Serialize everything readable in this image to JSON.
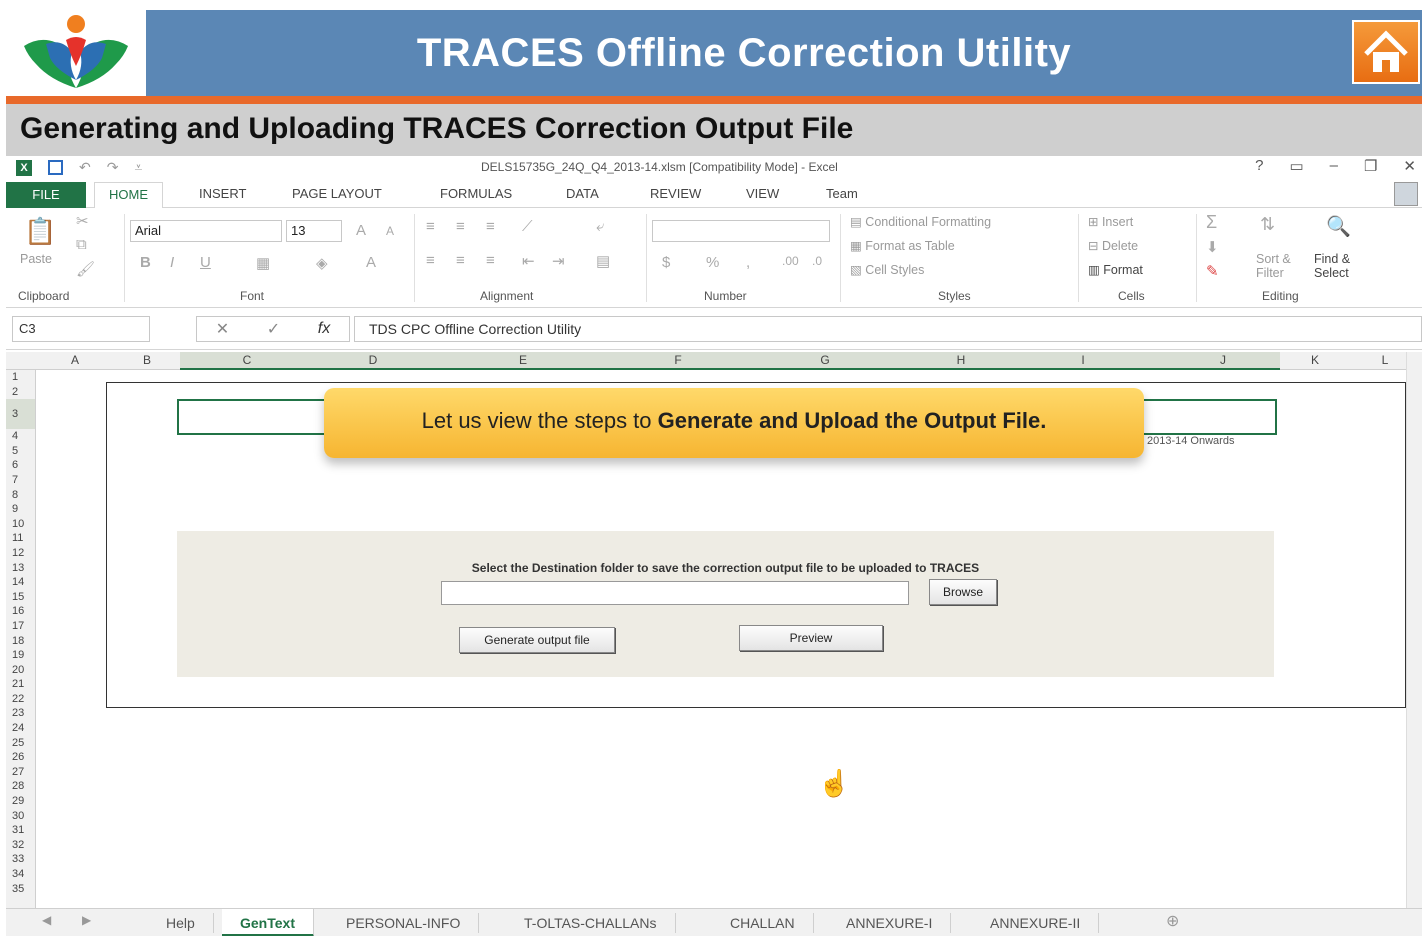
{
  "banner": {
    "title": "TRACES Offline Correction Utility",
    "subtitle": "Generating and Uploading TRACES Correction Output File"
  },
  "excel": {
    "document_title": "DELS15735G_24Q_Q4_2013-14.xlsm  [Compatibility Mode] - Excel",
    "tabs": {
      "file": "FILE",
      "home": "HOME",
      "insert": "INSERT",
      "page_layout": "PAGE LAYOUT",
      "formulas": "FORMULAS",
      "data": "DATA",
      "review": "REVIEW",
      "view": "VIEW",
      "team": "Team"
    },
    "ribbon": {
      "clipboard": {
        "paste": "Paste",
        "label": "Clipboard"
      },
      "font": {
        "family": "Arial",
        "size": "13",
        "label": "Font"
      },
      "alignment": {
        "label": "Alignment"
      },
      "number": {
        "label": "Number"
      },
      "styles": {
        "conditional": "Conditional Formatting",
        "format_table": "Format as Table",
        "cell_styles": "Cell Styles",
        "label": "Styles"
      },
      "cells": {
        "insert": "Insert",
        "delete": "Delete",
        "format": "Format",
        "label": "Cells"
      },
      "editing": {
        "sort": "Sort & Filter",
        "find": "Find & Select",
        "label": "Editing"
      }
    },
    "formula_bar": {
      "name_box": "C3",
      "formula": "TDS CPC Offline Correction Utility"
    },
    "columns": [
      "A",
      "B",
      "C",
      "D",
      "E",
      "F",
      "G",
      "H",
      "I",
      "J",
      "K",
      "L"
    ],
    "rows": [
      "1",
      "2",
      "3",
      "4",
      "5",
      "6",
      "7",
      "8",
      "9",
      "10",
      "11",
      "12",
      "13",
      "14",
      "15",
      "16",
      "17",
      "18",
      "19",
      "20",
      "21",
      "22",
      "23",
      "24",
      "25",
      "26",
      "27",
      "28",
      "29",
      "30",
      "31",
      "32",
      "33",
      "34",
      "35"
    ],
    "sheet": {
      "year_text": "2013-14 Onwards",
      "destination_label": "Select the Destination folder to save the correction output file to be uploaded to TRACES",
      "browse": "Browse",
      "generate": "Generate output file",
      "preview": "Preview"
    },
    "sheet_tabs": [
      "Help",
      "GenText",
      "PERSONAL-INFO",
      "T-OLTAS-CHALLANs",
      "CHALLAN",
      "ANNEXURE-I",
      "ANNEXURE-II"
    ],
    "active_sheet": "GenText"
  },
  "callout": {
    "prefix": "Let us view the steps to ",
    "bold": "Generate and Upload the Output File."
  },
  "colors": {
    "excel_green": "#217346",
    "banner_blue": "#5b87b5",
    "banner_orange": "#e8692a",
    "callout_yellow": "#f6b531"
  }
}
